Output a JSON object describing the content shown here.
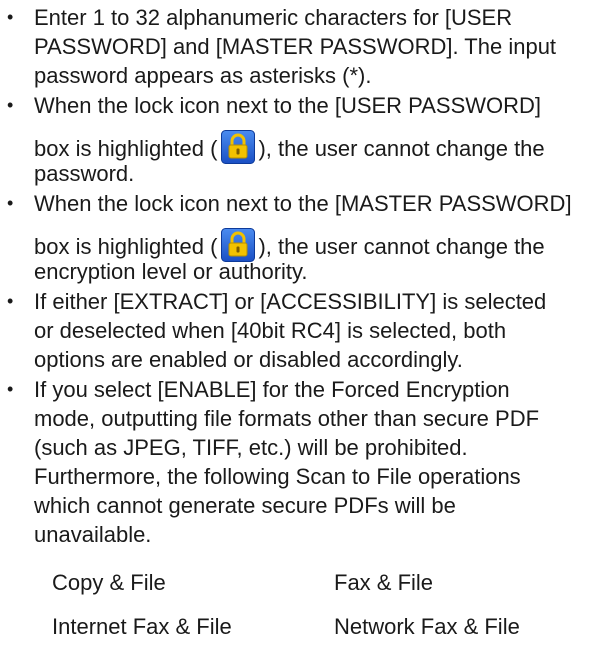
{
  "notes": [
    {
      "lines": [
        "Enter 1 to 32 alphanumeric characters for [USER",
        "PASSWORD] and [MASTER PASSWORD]. The input",
        "password appears as asterisks (*)."
      ]
    },
    {
      "line1": "When the lock icon next to the [USER PASSWORD]",
      "icon_before": "box is highlighted (",
      "icon_name": "lock-icon",
      "icon_after": "), the user cannot change the",
      "line3": "password."
    },
    {
      "line1": "When the lock icon next to the [MASTER PASSWORD]",
      "icon_before": "box is highlighted (",
      "icon_name": "lock-icon",
      "icon_after": "), the user cannot change the",
      "line3": "encryption level or authority."
    },
    {
      "lines": [
        "If either [EXTRACT] or [ACCESSIBILITY] is selected",
        "or deselected when [40bit RC4] is selected, both",
        "options are enabled or disabled accordingly."
      ]
    },
    {
      "lines": [
        "If you select [ENABLE] for the Forced Encryption",
        "mode, outputting file formats other than secure PDF",
        "(such as JPEG, TIFF, etc.) will be prohibited.",
        "Furthermore, the following Scan to File operations",
        "which cannot generate secure PDFs will be",
        "unavailable."
      ]
    }
  ],
  "operations": [
    "Copy & File",
    "Fax & File",
    "Internet Fax & File",
    "Network Fax & File"
  ],
  "colors": {
    "text": "#1a1a1a",
    "icon_bg": "#1f5fd6",
    "icon_lock": "#f2c200"
  }
}
